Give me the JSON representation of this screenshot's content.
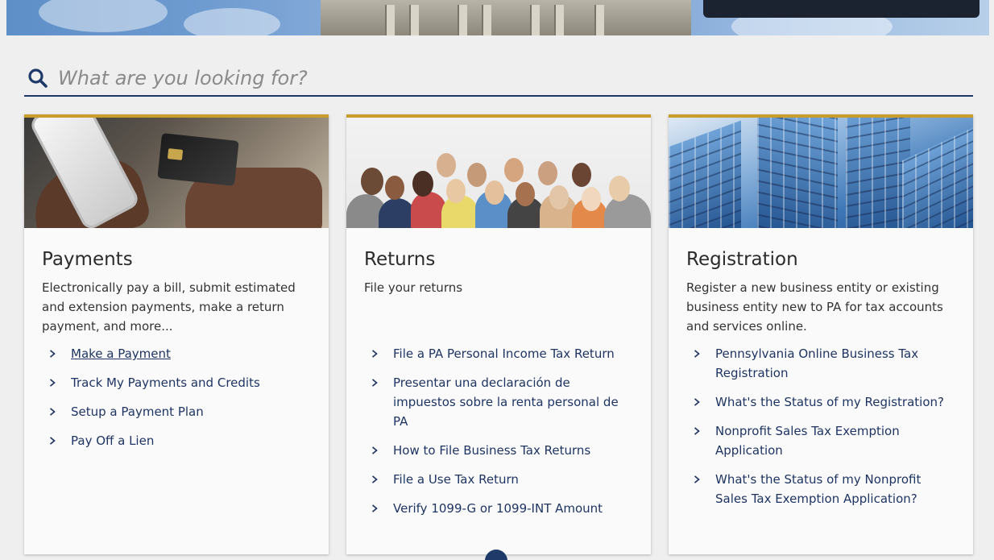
{
  "search": {
    "placeholder": "What are you looking for?"
  },
  "cards": [
    {
      "title": "Payments",
      "description": "Electronically pay a bill, submit estimated and extension payments, make a return payment, and more...",
      "links": [
        "Make a Payment",
        "Track My Payments and Credits",
        "Setup a Payment Plan",
        "Pay Off a Lien"
      ]
    },
    {
      "title": "Returns",
      "description": "File your returns",
      "links": [
        "File a PA Personal Income Tax Return",
        "Presentar una declaración de impuestos sobre la renta personal de PA",
        "How to File Business Tax Returns",
        "File a Use Tax Return",
        "Verify 1099-G or 1099-INT Amount"
      ]
    },
    {
      "title": "Registration",
      "description": "Register a new business entity or existing business entity new to PA for tax accounts and services online.",
      "links": [
        "Pennsylvania Online Business Tax Registration",
        "What's the Status of my Registration?",
        "Nonprofit Sales Tax Exemption Application",
        "What's the Status of my Nonprofit Sales Tax Exemption Application?"
      ]
    }
  ],
  "colors": {
    "accent_gold": "#c79e2c",
    "navy": "#1f3a68",
    "link": "#1e3563"
  }
}
